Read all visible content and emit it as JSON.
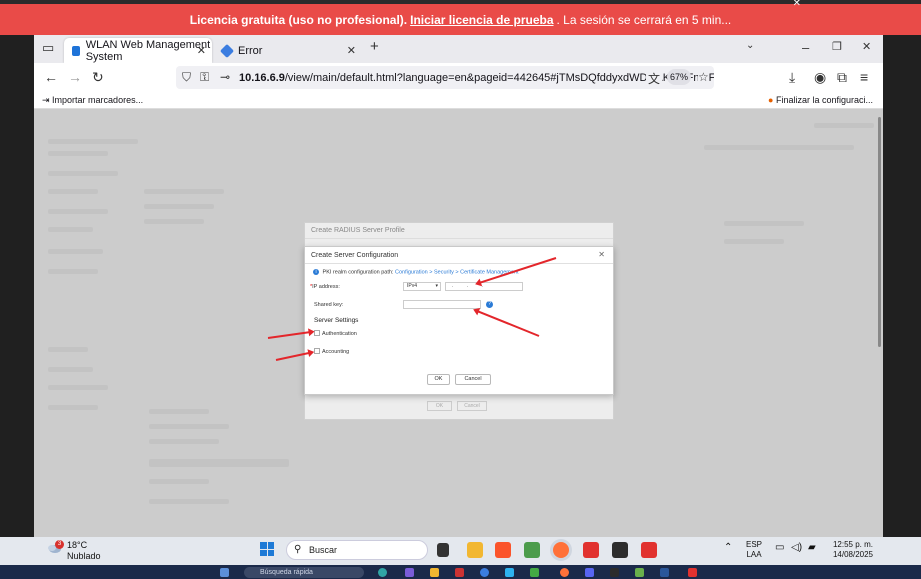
{
  "banner": {
    "text_before": "Licencia gratuita (uso no profesional).",
    "link": "Iniciar licencia de prueba",
    "text_after": ". La sesión se cerrará en 5 min...",
    "color": "#e94b48"
  },
  "browser": {
    "tabs": [
      {
        "label": "WLAN Web Management System",
        "active": true
      },
      {
        "label": "Error",
        "active": false
      }
    ],
    "url_prefix": "10.16.6.9",
    "url_rest": "/view/main/default.html?language=en&pageid=442645#jTMsDQfddyxdWDHAKrhFFnteFTp",
    "zoom": "67%",
    "bookmark_left": "Importar marcadores...",
    "bookmark_right": "Finalizar la configuraci..."
  },
  "background_dialog": {
    "title": "Create RADIUS Server Profile",
    "ok": "OK",
    "cancel": "Cancel"
  },
  "dialog": {
    "title": "Create Server Configuration",
    "info_prefix": "PKI realm configuration path:",
    "info_path": "Configuration > Security > Certificate Management",
    "ip_label": "IP address:",
    "ip_type": "IPv4",
    "ip_value": ". . .",
    "shared_key_label": "Shared key:",
    "shared_key_value": "",
    "section": "Server Settings",
    "authentication_label": "Authentication",
    "authentication_checked": false,
    "accounting_label": "Accounting",
    "accounting_checked": false,
    "ok": "OK",
    "cancel": "Cancel"
  },
  "taskbar": {
    "temperature": "18°C",
    "weather": "Nublado",
    "weather_badge": "3",
    "search_placeholder": "Buscar",
    "lang_top": "ESP",
    "lang_bottom": "LAA",
    "time": "12:55 p. m.",
    "date": "14/08/2025"
  },
  "second_taskbar": {
    "search_placeholder": "Búsqueda rápida"
  },
  "annotation_color": "#e3262b"
}
